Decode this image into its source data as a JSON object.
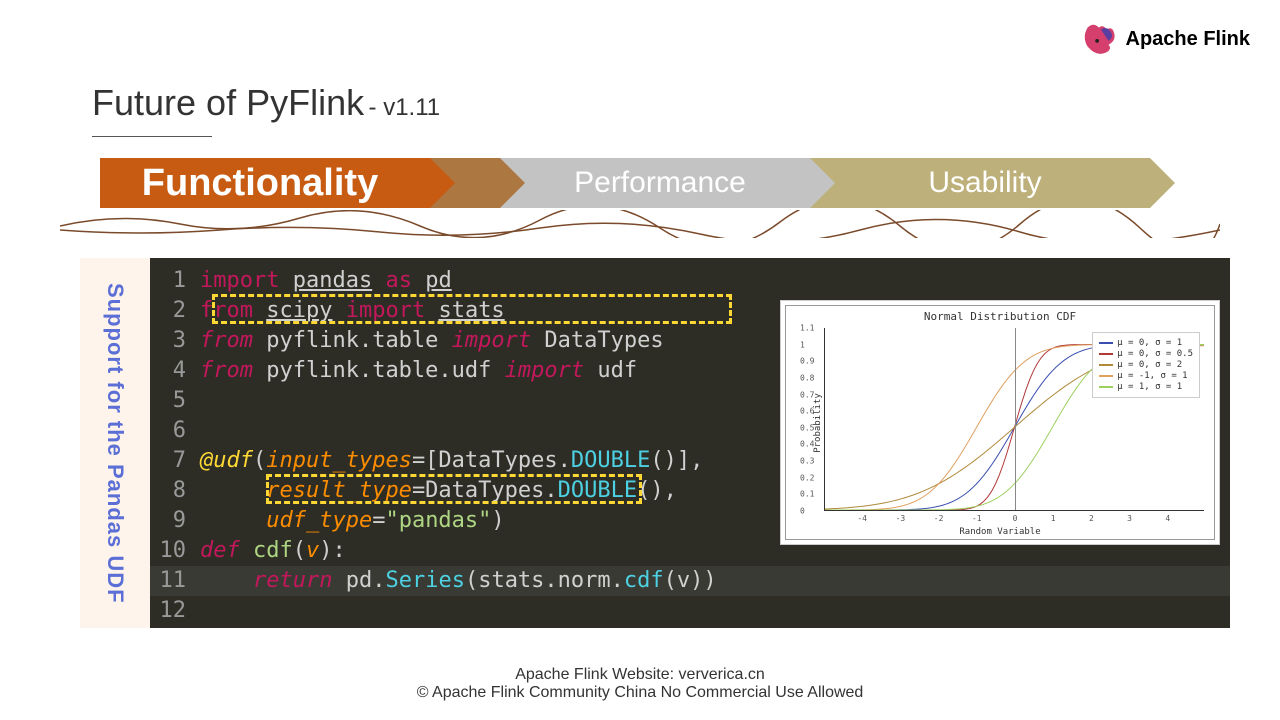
{
  "logo": {
    "text": "Apache Flink"
  },
  "title": {
    "main": "Future of PyFlink",
    "sub": "- v1.11"
  },
  "tabs": {
    "t1": "Functionality",
    "t2": "Performance",
    "t3": "Usability"
  },
  "sidebar": {
    "label": "Support for the Pandas UDF"
  },
  "code": {
    "lines": [
      {
        "n": "1"
      },
      {
        "n": "2"
      },
      {
        "n": "3"
      },
      {
        "n": "4"
      },
      {
        "n": "5"
      },
      {
        "n": "6"
      },
      {
        "n": "7"
      },
      {
        "n": "8"
      },
      {
        "n": "9"
      },
      {
        "n": "10"
      },
      {
        "n": "11"
      },
      {
        "n": "12"
      }
    ],
    "tokens": {
      "import": "import",
      "from": "from",
      "as": "as",
      "def": "def",
      "return": "return",
      "pandas": "pandas",
      "pd": "pd",
      "scipy": "scipy",
      "stats": "stats",
      "pyflink_table": "pyflink.table",
      "datatypes": "DataTypes",
      "pyflink_udf": "pyflink.table.udf",
      "udf": "udf",
      "atudf": "@udf",
      "input_types": "input_types",
      "double": "DOUBLE",
      "result_type": "result_type",
      "udf_type": "udf_type",
      "pandas_str": "\"pandas\"",
      "cdf": "cdf",
      "v": "v",
      "series": "Series",
      "norm": "norm"
    }
  },
  "chart_data": {
    "type": "line",
    "title": "Normal Distribution CDF",
    "xlabel": "Random Variable",
    "ylabel": "Probability",
    "xlim": [
      -5,
      5
    ],
    "ylim": [
      0,
      1.1
    ],
    "xticks": [
      -4,
      -3,
      -2,
      -1,
      0,
      1,
      2,
      3,
      4
    ],
    "yticks": [
      0,
      0.1,
      0.2,
      0.3,
      0.4,
      0.5,
      0.6,
      0.7,
      0.8,
      0.9,
      1.0,
      1.1
    ],
    "series": [
      {
        "name": "μ = 0, σ = 1",
        "color": "#3a4fb0",
        "mu": 0,
        "sigma": 1
      },
      {
        "name": "μ = 0, σ = 0.5",
        "color": "#b03a3a",
        "mu": 0,
        "sigma": 0.5
      },
      {
        "name": "μ = 0, σ = 2",
        "color": "#b08a3a",
        "mu": 0,
        "sigma": 2
      },
      {
        "name": "μ = -1, σ = 1",
        "color": "#e0a060",
        "mu": -1,
        "sigma": 1
      },
      {
        "name": "μ = 1, σ = 1",
        "color": "#9ed060",
        "mu": 1,
        "sigma": 1
      }
    ]
  },
  "footer": {
    "l1": "Apache Flink Website: ververica.cn",
    "l2": "© Apache Flink Community China   No Commercial Use Allowed"
  }
}
